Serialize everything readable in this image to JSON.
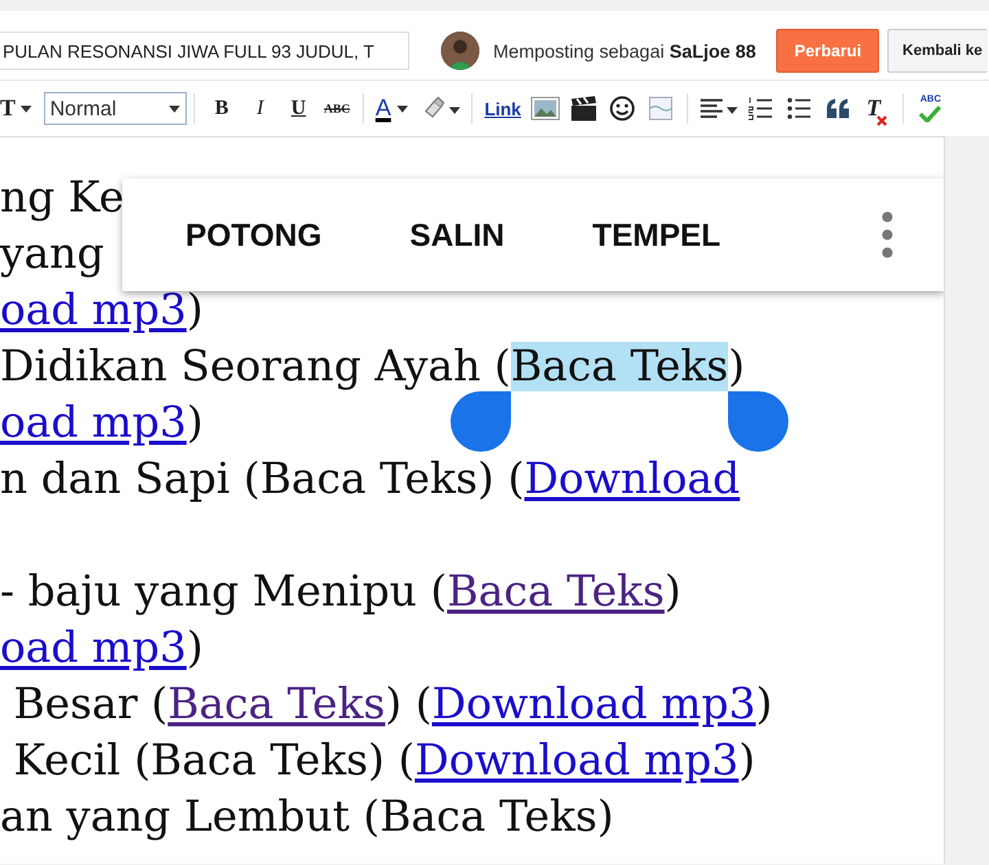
{
  "post_title": {
    "value": "PULAN RESONANSI JIWA FULL 93 JUDUL, T"
  },
  "author": {
    "prefix": "Memposting sebagai",
    "name": "SaLjoe 88"
  },
  "buttons": [
    {
      "label": "Perbarui",
      "kind": "primary"
    },
    {
      "label": "Kembali ke",
      "kind": "secondary"
    }
  ],
  "toolbar": [
    {
      "kind": "font",
      "label": "T"
    },
    {
      "kind": "select",
      "label": "Normal"
    },
    {
      "kind": "divider"
    },
    {
      "kind": "bold",
      "label": "B"
    },
    {
      "kind": "italic",
      "label": "I"
    },
    {
      "kind": "underline",
      "label": "U"
    },
    {
      "kind": "strike",
      "label": "ABC"
    },
    {
      "kind": "divider"
    },
    {
      "kind": "color",
      "label": "A"
    },
    {
      "kind": "highlight"
    },
    {
      "kind": "divider"
    },
    {
      "kind": "link",
      "label": "Link"
    },
    {
      "kind": "image"
    },
    {
      "kind": "video"
    },
    {
      "kind": "emoji"
    },
    {
      "kind": "jump"
    },
    {
      "kind": "divider"
    },
    {
      "kind": "align"
    },
    {
      "kind": "ol"
    },
    {
      "kind": "ul"
    },
    {
      "kind": "quote"
    },
    {
      "kind": "clear",
      "label": "T"
    },
    {
      "kind": "divider"
    },
    {
      "kind": "spell",
      "label": "ABC"
    }
  ],
  "lines": [
    {
      "segments": [
        {
          "text": "ng Ke",
          "kind": "plain",
          "selected": false
        }
      ]
    },
    {
      "segments": [
        {
          "text": "yang",
          "kind": "plain",
          "selected": false
        }
      ]
    },
    {
      "segments": [
        {
          "text": "oad mp3",
          "kind": "link",
          "selected": false
        },
        {
          "text": ")",
          "kind": "plain",
          "selected": false
        }
      ]
    },
    {
      "segments": [
        {
          "text": "Didikan Seorang Ayah (",
          "kind": "plain",
          "selected": false
        },
        {
          "text": "Baca Teks",
          "kind": "plain",
          "selected": true
        },
        {
          "text": ")",
          "kind": "plain",
          "selected": false
        }
      ]
    },
    {
      "segments": [
        {
          "text": "oad mp3",
          "kind": "link",
          "selected": false
        },
        {
          "text": ")",
          "kind": "plain",
          "selected": false
        }
      ]
    },
    {
      "segments": [
        {
          "text": "n dan Sapi (Baca Teks) (",
          "kind": "plain",
          "selected": false
        },
        {
          "text": "Download ",
          "kind": "link",
          "selected": false
        }
      ]
    },
    {
      "blank_before": true,
      "segments": [
        {
          "text": "- baju yang Menipu (",
          "kind": "plain",
          "selected": false
        },
        {
          "text": "Baca Teks",
          "kind": "visited",
          "selected": false
        },
        {
          "text": ")",
          "kind": "plain",
          "selected": false
        }
      ]
    },
    {
      "segments": [
        {
          "text": "oad mp3",
          "kind": "link",
          "selected": false
        },
        {
          "text": ")",
          "kind": "plain",
          "selected": false
        }
      ]
    },
    {
      "segments": [
        {
          "text": " Besar (",
          "kind": "plain",
          "selected": false
        },
        {
          "text": "Baca Teks",
          "kind": "visited",
          "selected": false
        },
        {
          "text": ") (",
          "kind": "plain",
          "selected": false
        },
        {
          "text": "Download mp3",
          "kind": "link",
          "selected": false
        },
        {
          "text": ")",
          "kind": "plain",
          "selected": false
        }
      ]
    },
    {
      "segments": [
        {
          "text": " Kecil (Baca Teks) (",
          "kind": "plain",
          "selected": false
        },
        {
          "text": "Download mp3",
          "kind": "link",
          "selected": false
        },
        {
          "text": ")",
          "kind": "plain",
          "selected": false
        }
      ]
    },
    {
      "segments": [
        {
          "text": "an yang Lembut (Baca Teks)",
          "kind": "plain",
          "selected": false
        }
      ]
    }
  ],
  "context_menu": {
    "items": [
      "POTONG",
      "SALIN",
      "TEMPEL"
    ]
  }
}
